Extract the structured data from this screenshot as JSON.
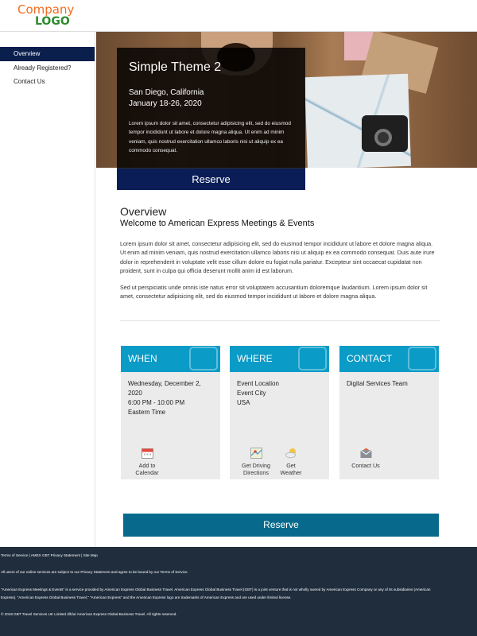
{
  "header": {
    "logo_line1": "Company",
    "logo_line2": "LOGO"
  },
  "sidebar": {
    "items": [
      {
        "label": "Overview",
        "active": true
      },
      {
        "label": "Already Registered?",
        "active": false
      },
      {
        "label": "Contact Us",
        "active": false
      }
    ]
  },
  "hero": {
    "title": "Simple Theme 2",
    "location": "San Diego, California",
    "dates": "January 18-26, 2020",
    "text": "Lorem ipsum dolor sit amet, consectetur adipisicing elit, sed do eiusmod tempor incididunt ut labore et dolore magna aliqua. Ut enim ad minim veniam, quis nostrud exercitation ullamco laboris nisi ut aliquip ex ea commodo consequat.",
    "reserve_label": "Reserve"
  },
  "overview": {
    "title": "Overview",
    "subtitle": "Welcome to American Express Meetings & Events",
    "paragraph1": "Lorem ipsum dolor sit amet, consectetur adipisicing elit, sed do eiusmod tempor incididunt ut labore et dolore magna aliqua. Ut enim ad minim veniam, quis nostrud exercitation ullamco laboris nisi ut aliquip ex ea commodo consequat. Duis aute irure dolor in reprehenderit in voluptate velit esse cillum dolore eu fugiat nulla pariatur. Excepteur sint occaecat cupidatat non proident, sunt in culpa qui officia deserunt mollit anim id est laborum.",
    "paragraph2": "Sed ut perspiciatis unde omnis iste natus error sit voluptatem accusantium doloremque laudantium. Lorem ipsum dolor sit amet, consectetur adipisicing elit, sed do eiusmod tempor incididunt ut labore et dolore magna aliqua."
  },
  "cards": {
    "when": {
      "title": "WHEN",
      "date": "Wednesday, December 2, 2020",
      "time": "6:00 PM - 10:00 PM",
      "tz": "Eastern Time",
      "action_line1": "Add to",
      "action_line2": "Calendar",
      "icon": "calendar-icon"
    },
    "where": {
      "title": "WHERE",
      "line1": "Event Location",
      "line2": "Event City",
      "line3": "USA",
      "action1_line1": "Get Driving",
      "action1_line2": "Directions",
      "action2_line1": "Get",
      "action2_line2": "Weather",
      "icons": [
        "map-icon",
        "weather-icon"
      ]
    },
    "contact": {
      "title": "CONTACT",
      "line1": "Digital Services Team",
      "action_label": "Contact Us",
      "icon": "envelope-icon"
    }
  },
  "main_reserve_label": "Reserve",
  "footer": {
    "links": [
      "Terms of Service",
      "AMEX GBT Privacy Statement",
      "Site Map"
    ],
    "separator": " | ",
    "notice": "All users of our online services are subject to our Privacy Statement and agree to be bound by our Terms of Service.",
    "legal1": "\"American Express Meetings & Events\" is a service provided by American Express Global Business Travel. American Express Global Business Travel (GBT) is a joint venture that is not wholly owned by American Express Company or any of its subsidiaries (American",
    "legal2": "Express). \"American Express Global Business Travel,\" \"American Express\" and the American Express logo are trademarks of American Express and are used under limited license.",
    "copyright": "© 2018 GBT Travel Services UK Limited d/b/a/ American Express Global Business Travel. All rights reserved."
  },
  "colors": {
    "nav_active": "#0b1f4d",
    "hero_reserve": "#0a1d56",
    "card_header": "#0a9bc7",
    "main_reserve": "#076a8c",
    "footer": "#1f2d3d"
  }
}
